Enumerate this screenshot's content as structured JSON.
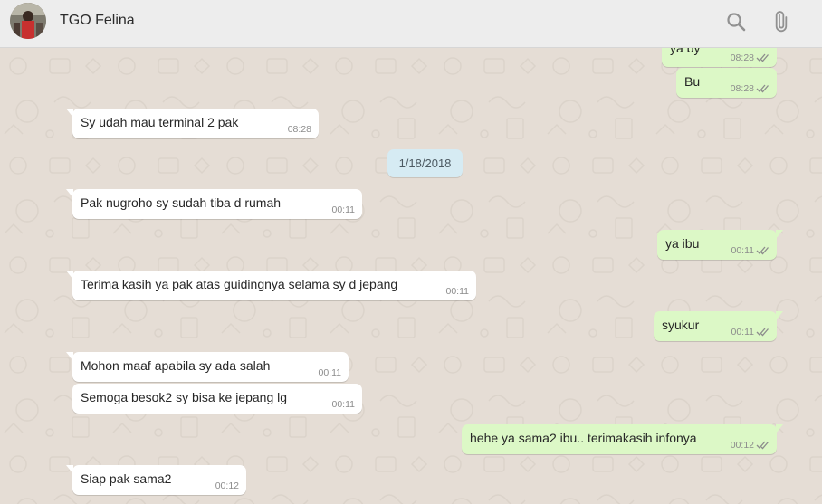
{
  "header": {
    "contact_name": "TGO Felina",
    "avatar_icon": "contact-avatar",
    "search_icon": "search-icon",
    "attach_icon": "paperclip-icon"
  },
  "colors": {
    "incoming_bubble": "#ffffff",
    "outgoing_bubble": "#dcf8c6",
    "date_chip": "#d6ebf3",
    "chat_background": "#e5ddd5",
    "header_background": "#ededed"
  },
  "messages": [
    {
      "direction": "out",
      "text": "ya by",
      "time": "08:28",
      "status": "read"
    },
    {
      "direction": "out",
      "text": "Bu",
      "time": "08:28",
      "status": "read"
    },
    {
      "direction": "in",
      "text": "Sy udah mau terminal 2 pak",
      "time": "08:28"
    },
    {
      "direction": "date",
      "text": "1/18/2018"
    },
    {
      "direction": "in",
      "text": "Pak nugroho sy sudah tiba d rumah",
      "time": "00:11"
    },
    {
      "direction": "out",
      "text": "ya ibu",
      "time": "00:11",
      "status": "read"
    },
    {
      "direction": "in",
      "text": "Terima kasih ya pak atas guidingnya selama sy d jepang",
      "time": "00:11"
    },
    {
      "direction": "out",
      "text": "syukur",
      "time": "00:11",
      "status": "read"
    },
    {
      "direction": "in",
      "text": "Mohon maaf apabila sy ada salah",
      "time": "00:11"
    },
    {
      "direction": "in",
      "text": "Semoga besok2 sy bisa ke jepang lg",
      "time": "00:11"
    },
    {
      "direction": "out",
      "text": "hehe ya sama2 ibu.. terimakasih infonya",
      "time": "00:12",
      "status": "read"
    },
    {
      "direction": "in",
      "text": "Siap pak sama2",
      "time": "00:12"
    }
  ]
}
